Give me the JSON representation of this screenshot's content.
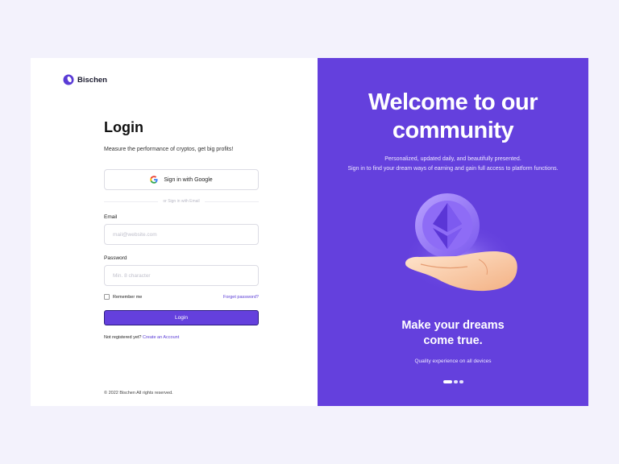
{
  "brand": {
    "name": "Bischen"
  },
  "login": {
    "title": "Login",
    "subtitle": "Measure the performance of cryptos, get big profits!",
    "google_label": "Sign in with Google",
    "divider_text": "or Sign in with Email",
    "email_label": "Email",
    "email_placeholder": "mail@website.com",
    "password_label": "Password",
    "password_placeholder": "Min. 8 character",
    "remember_label": "Remember me",
    "forgot_label": "Forget password?",
    "login_button": "Login",
    "register_prompt": "Not registered yet?",
    "register_link": "Create an Account"
  },
  "footer": {
    "copyright": "© 2022 Bischen All rights reserved."
  },
  "promo": {
    "headline_line1": "Welcome to our",
    "headline_line2": "community",
    "desc_line1": "Personalized, updated daily, and beautifully presented.",
    "desc_line2": "Sign in to find your dream ways of earning and gain full access to platform functions.",
    "tagline_line1": "Make your dreams",
    "tagline_line2": "come true.",
    "subtagline": "Quality experience on all devices",
    "illustration_icon": "hand-holding-crypto-coin-icon",
    "carousel_active_index": 0,
    "carousel_count": 3
  },
  "colors": {
    "accent": "#6440dd",
    "page_bg": "#f3f2fc",
    "link": "#5a3bd6"
  }
}
